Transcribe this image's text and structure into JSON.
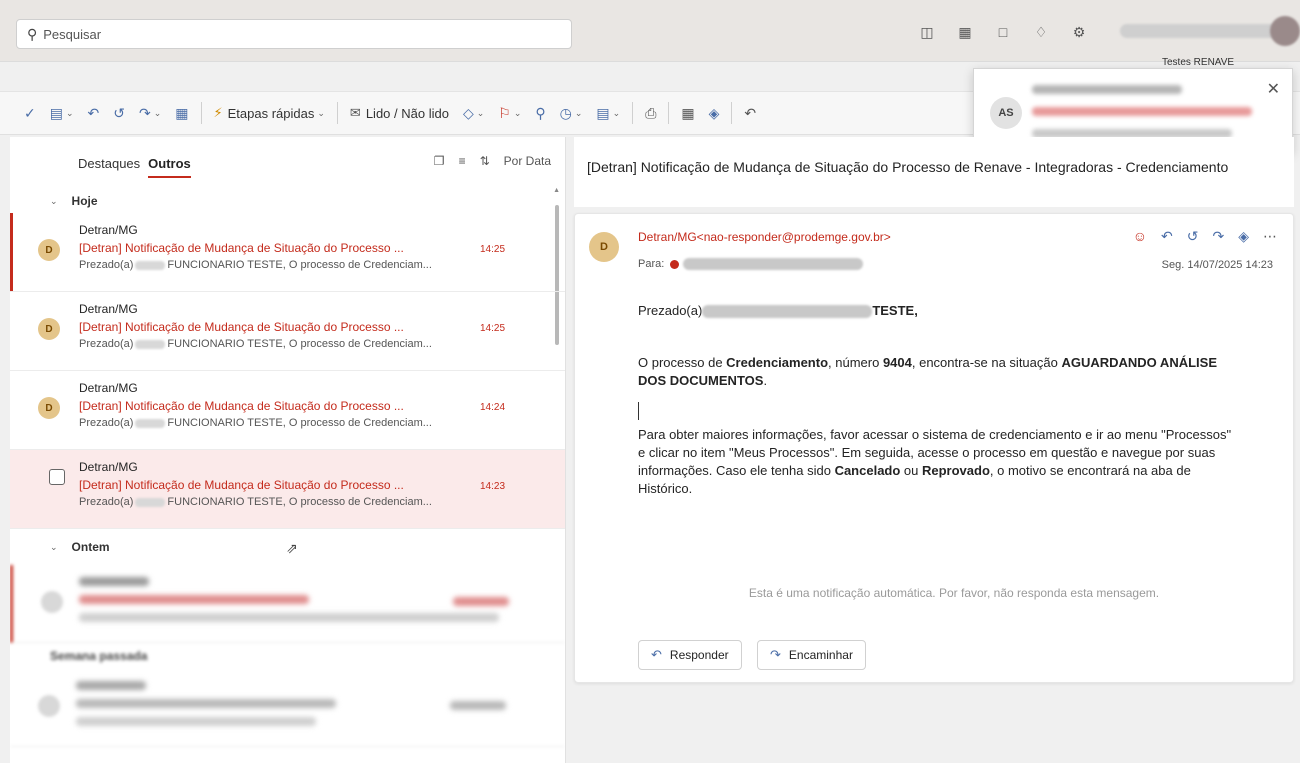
{
  "search": {
    "placeholder": "Pesquisar"
  },
  "profile": {
    "name": "Testes RENAVE"
  },
  "ribbon": {
    "quick_steps": "Etapas rápidas",
    "read_unread": "Lido / Não lido"
  },
  "toast": {
    "initials": "AS"
  },
  "list": {
    "tabs": [
      "Destaques",
      "Outros"
    ],
    "sort_label": "Por Data",
    "groups": {
      "today": "Hoje",
      "yesterday": "Ontem",
      "last_week": "Semana passada"
    },
    "items": [
      {
        "initial": "D",
        "sender": "Detran/MG",
        "subject": "[Detran] Notificação de Mudança de Situação do Processo ...",
        "time": "14:25",
        "preview_prefix": "Prezado(a)",
        "preview_suffix": "FUNCIONARIO TESTE, O processo de Credenciam..."
      },
      {
        "initial": "D",
        "sender": "Detran/MG",
        "subject": "[Detran] Notificação de Mudança de Situação do Processo ...",
        "time": "14:25",
        "preview_prefix": "Prezado(a)",
        "preview_suffix": "FUNCIONARIO TESTE, O processo de Credenciam..."
      },
      {
        "initial": "D",
        "sender": "Detran/MG",
        "subject": "[Detran] Notificação de Mudança de Situação do Processo ...",
        "time": "14:24",
        "preview_prefix": "Prezado(a)",
        "preview_suffix": "FUNCIONARIO TESTE, O processo de Credenciam..."
      },
      {
        "initial": "",
        "sender": "Detran/MG",
        "subject": "[Detran] Notificação de Mudança de Situação do Processo ...",
        "time": "14:23",
        "preview_prefix": "Prezado(a)",
        "preview_suffix": "FUNCIONARIO TESTE, O processo de Credenciam..."
      }
    ]
  },
  "message": {
    "title": "[Detran] Notificação de Mudança de Situação do Processo de Renave - Integradoras - Credenciamento",
    "initial": "D",
    "from": "Detran/MG<nao-responder@prodemge.gov.br>",
    "to_label": "Para:",
    "date": "Seg. 14/07/2025 14:23",
    "greeting_prefix": "Prezado(a)",
    "greeting_suffix": "TESTE,",
    "p1_a": "O processo de ",
    "p1_b": "Credenciamento",
    "p1_c": ", número ",
    "p1_d": "9404",
    "p1_e": ", encontra-se na situação ",
    "p1_f": "AGUARDANDO ANÁLISE DOS DOCUMENTOS",
    "p1_g": ".",
    "p2_a": "Para obter maiores informações, favor acessar o sistema de credenciamento e ir ao menu \"Processos\" e clicar no item \"Meus Processos\". Em seguida, acesse o processo em questão e navegue por suas informações. Caso ele tenha sido ",
    "p2_b": "Cancelado",
    "p2_c": " ou ",
    "p2_d": "Reprovado",
    "p2_e": ", o motivo se encontrará na aba de Histórico.",
    "footer": "Esta é uma notificação automática. Por favor, não responda esta mensagem.",
    "reply": "Responder",
    "forward": "Encaminhar"
  }
}
